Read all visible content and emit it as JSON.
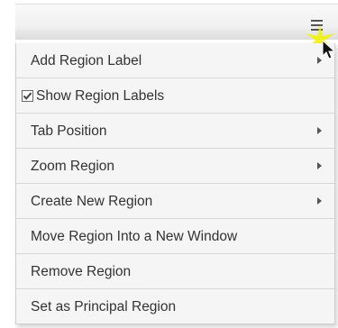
{
  "menu": {
    "items": [
      {
        "label": "Add Region Label",
        "submenu": true
      },
      {
        "label": "Show Region Labels",
        "checked": true
      },
      {
        "label": "Tab Position",
        "submenu": true
      },
      {
        "label": "Zoom Region",
        "submenu": true
      },
      {
        "label": "Create New Region",
        "submenu": true
      },
      {
        "label": "Move Region Into a New Window"
      },
      {
        "label": "Remove Region"
      },
      {
        "label": "Set as Principal Region"
      }
    ]
  },
  "icons": {
    "menu_button": "hamburger-menu-icon",
    "checked": "checkbox-checked-icon",
    "submenu": "chevron-right-icon",
    "cursor": "mouse-pointer-icon"
  },
  "colors": {
    "menu_background": "#f5f5f5",
    "divider": "#d7d7d7",
    "text": "#333333",
    "cursor_highlight": "#f2f200"
  }
}
